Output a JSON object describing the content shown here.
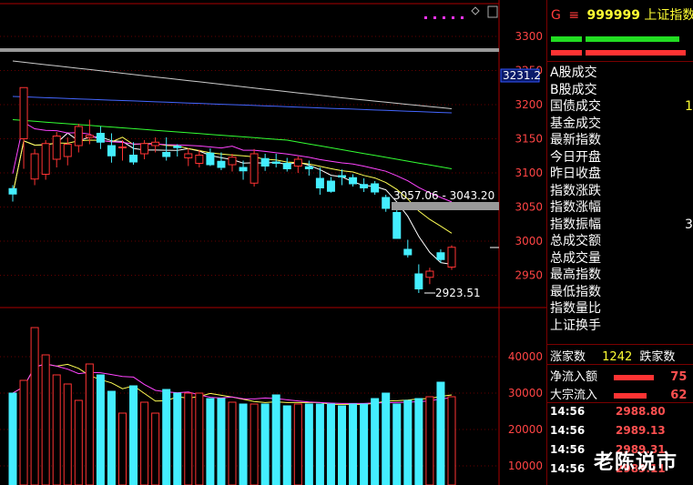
{
  "panel": {
    "market_letter": "G",
    "menu_glyph": "≡",
    "index_code": "999999",
    "index_name": "上证指数",
    "fields": [
      "A股成交",
      "B股成交",
      "国债成交",
      "基金成交",
      "最新指数",
      "今日开盘",
      "昨日收盘",
      "指数涨跌",
      "指数涨幅",
      "指数振幅",
      "总成交额",
      "总成交量",
      "最高指数",
      "最低指数",
      "指数量比",
      "上证换手"
    ],
    "partial_values": {
      "国债成交": "1",
      "指数振幅": "3"
    },
    "rise_label": "涨家数",
    "rise_value": "1242",
    "fall_label": "跌家数",
    "net_inflow_label": "净流入额",
    "net_inflow_value": "75",
    "bulk_inflow_label": "大宗流入",
    "bulk_inflow_value": "62",
    "ticks": [
      {
        "time": "14:56",
        "price": "2988.80"
      },
      {
        "time": "14:56",
        "price": "2989.13"
      },
      {
        "time": "14:56",
        "price": "2989.31"
      },
      {
        "time": "14:56",
        "price": "2989.11"
      }
    ],
    "watermark": "老陈说市"
  },
  "chart_data": {
    "type": "candlestick",
    "price_axis": {
      "ticks": [
        3300,
        3250,
        3200,
        3150,
        3100,
        3050,
        3000,
        2950
      ],
      "range": [
        2900,
        3320
      ]
    },
    "volume_axis": {
      "ticks": [
        40000,
        30000,
        20000,
        10000
      ],
      "range": [
        5000,
        50000
      ]
    },
    "last_price_tag": "3231.2",
    "annotations": {
      "high_range": "3057.06 - 3043.20",
      "low_point": "2923.51"
    },
    "colors": {
      "up": "#ff3333",
      "down": "#44eeff",
      "ma5": "#ffffff",
      "ma10": "#ffff55",
      "ma20": "#ff44ff",
      "ma60": "#33ff33",
      "ma120": "#4466ff",
      "ma250": "#cccccc",
      "vma5": "#ffff55",
      "vma10": "#ff44ff"
    },
    "candles": [
      [
        3077,
        3082,
        3058,
        3069
      ],
      [
        3150,
        3225,
        3106,
        3225
      ],
      [
        3091,
        3135,
        3082,
        3128
      ],
      [
        3098,
        3148,
        3090,
        3143
      ],
      [
        3120,
        3160,
        3108,
        3154
      ],
      [
        3124,
        3152,
        3111,
        3142
      ],
      [
        3140,
        3172,
        3130,
        3168
      ],
      [
        3152,
        3178,
        3142,
        3155
      ],
      [
        3158,
        3168,
        3135,
        3145
      ],
      [
        3140,
        3158,
        3115,
        3125
      ],
      [
        3138,
        3148,
        3118,
        3138
      ],
      [
        3126,
        3145,
        3112,
        3116
      ],
      [
        3128,
        3148,
        3120,
        3143
      ],
      [
        3140,
        3152,
        3130,
        3145
      ],
      [
        3130,
        3152,
        3118,
        3124
      ],
      [
        3139,
        3142,
        3124,
        3137
      ],
      [
        3122,
        3136,
        3110,
        3128
      ],
      [
        3114,
        3134,
        3108,
        3126
      ],
      [
        3129,
        3136,
        3110,
        3112
      ],
      [
        3117,
        3130,
        3104,
        3108
      ],
      [
        3112,
        3128,
        3102,
        3123
      ],
      [
        3108,
        3118,
        3090,
        3103
      ],
      [
        3085,
        3135,
        3080,
        3128
      ],
      [
        3121,
        3128,
        3103,
        3110
      ],
      [
        3116,
        3128,
        3108,
        3114
      ],
      [
        3114,
        3122,
        3102,
        3106
      ],
      [
        3110,
        3124,
        3100,
        3120
      ],
      [
        3109,
        3118,
        3096,
        3106
      ],
      [
        3092,
        3108,
        3068,
        3078
      ],
      [
        3088,
        3094,
        3071,
        3073
      ],
      [
        3096,
        3105,
        3082,
        3094
      ],
      [
        3093,
        3098,
        3080,
        3084
      ],
      [
        3083,
        3092,
        3072,
        3078
      ],
      [
        3084,
        3088,
        3068,
        3072
      ],
      [
        3064,
        3068,
        3043,
        3048
      ],
      [
        3042,
        3046,
        3004,
        3004
      ],
      [
        2988,
        3002,
        2976,
        2980
      ],
      [
        2952,
        2966,
        2924,
        2930
      ],
      [
        2947,
        2961,
        2937,
        2956
      ],
      [
        2983,
        2988,
        2968,
        2973
      ],
      [
        2962,
        2994,
        2958,
        2991
      ]
    ],
    "volumes": [
      30000,
      33500,
      48000,
      40500,
      35000,
      32500,
      28000,
      38000,
      35000,
      30500,
      24500,
      32000,
      27500,
      24500,
      31000,
      30000,
      30000,
      30000,
      28500,
      28500,
      27500,
      27000,
      27000,
      27000,
      29500,
      26500,
      27000,
      27000,
      27000,
      27000,
      26500,
      27000,
      27000,
      28500,
      30000,
      27000,
      28000,
      28500,
      29000,
      33000,
      29000
    ]
  }
}
